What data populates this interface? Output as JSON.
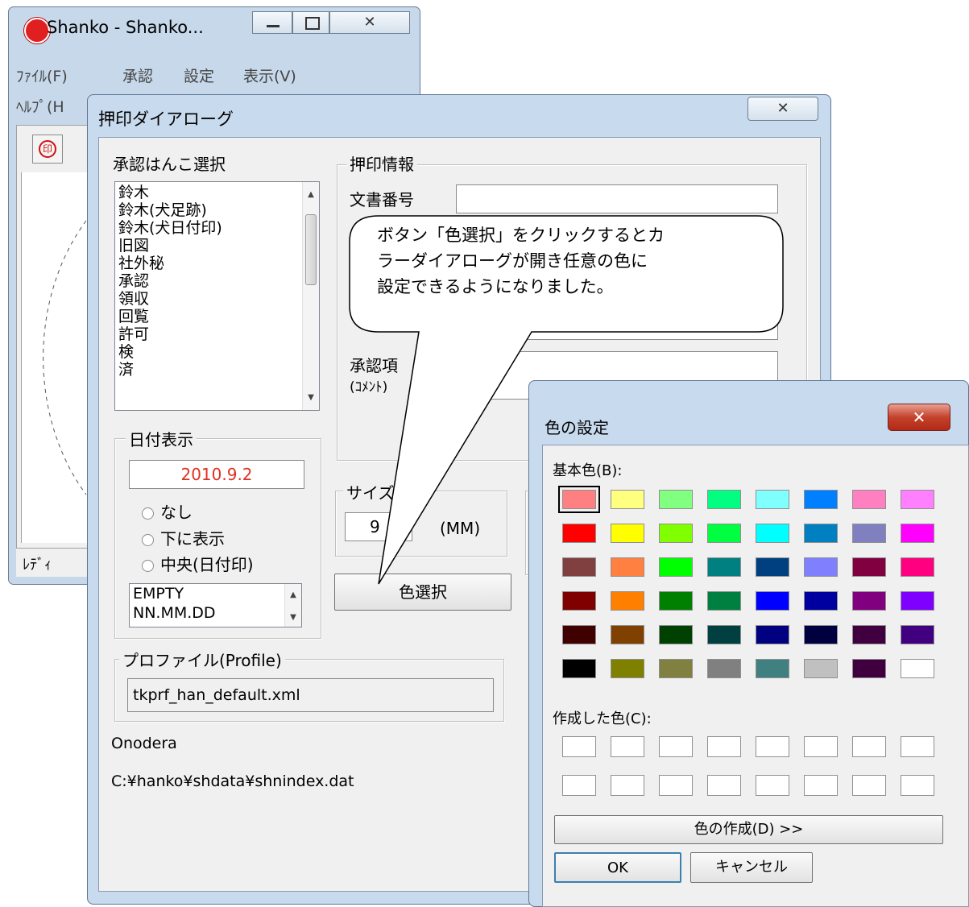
{
  "main_window": {
    "title": "Shanko - Shanko...",
    "menu": [
      "ﾌｧｲﾙ(F)",
      "承認",
      "設定",
      "表示(V)"
    ],
    "menu2": "ﾍﾙﾌﾟ(H",
    "status": "ﾚﾃﾞｨ",
    "toolbar_icon": "stamp-icon"
  },
  "stamp_dialog": {
    "title": "押印ダイアローグ",
    "close_label": "✕",
    "hanko_group": "承認はんこ選択",
    "hanko_list": [
      "鈴木",
      "鈴木(犬足跡)",
      "鈴木(犬日付印)",
      "旧図",
      "社外秘",
      "承認",
      "領収",
      "回覧",
      "許可",
      "検",
      "済"
    ],
    "info_group": "押印情報",
    "doc_number_label": "文書番号",
    "doc_number_value": "",
    "approval_label": "承認項",
    "approval_sub": "(ｺﾒﾝﾄ)",
    "date_group": "日付表示",
    "date_value": "2010.9.2",
    "date_color": "#e03020",
    "date_options": [
      "なし",
      "下に表示",
      "中央(日付印)"
    ],
    "date_formats": [
      "EMPTY",
      "NN.MM.DD"
    ],
    "size_group": "サイズ",
    "size_value": "9",
    "size_unit": "(MM)",
    "color_button": "色選択",
    "profile_group": "プロファイル(Profile)",
    "profile_value": "tkprf_han_default.xml",
    "user": "Onodera",
    "path": "C:¥hanko¥shdata¥shnindex.dat"
  },
  "callout": {
    "lines": [
      "ボタン「色選択」をクリックするとカ",
      "ラーダイアローグが開き任意の色に",
      "設定できるようになりました。"
    ]
  },
  "color_dialog": {
    "title": "色の設定",
    "close_label": "✕",
    "basic_label": "基本色(B):",
    "custom_label": "作成した色(C):",
    "define_button": "色の作成(D) >>",
    "ok_button": "OK",
    "cancel_button": "キャンセル",
    "basic_colors": [
      [
        "#ff8080",
        "#ffff80",
        "#80ff80",
        "#00ff80",
        "#80ffff",
        "#0080ff",
        "#ff80c0",
        "#ff80ff"
      ],
      [
        "#ff0000",
        "#ffff00",
        "#80ff00",
        "#00ff40",
        "#00ffff",
        "#0080c0",
        "#8080c0",
        "#ff00ff"
      ],
      [
        "#804040",
        "#ff8040",
        "#00ff00",
        "#008080",
        "#004080",
        "#8080ff",
        "#800040",
        "#ff0080"
      ],
      [
        "#800000",
        "#ff8000",
        "#008000",
        "#008040",
        "#0000ff",
        "#0000a0",
        "#800080",
        "#8000ff"
      ],
      [
        "#400000",
        "#804000",
        "#004000",
        "#004040",
        "#000080",
        "#000040",
        "#400040",
        "#400080"
      ],
      [
        "#000000",
        "#808000",
        "#808040",
        "#808080",
        "#408080",
        "#c0c0c0",
        "#400040",
        "#ffffff"
      ]
    ]
  }
}
